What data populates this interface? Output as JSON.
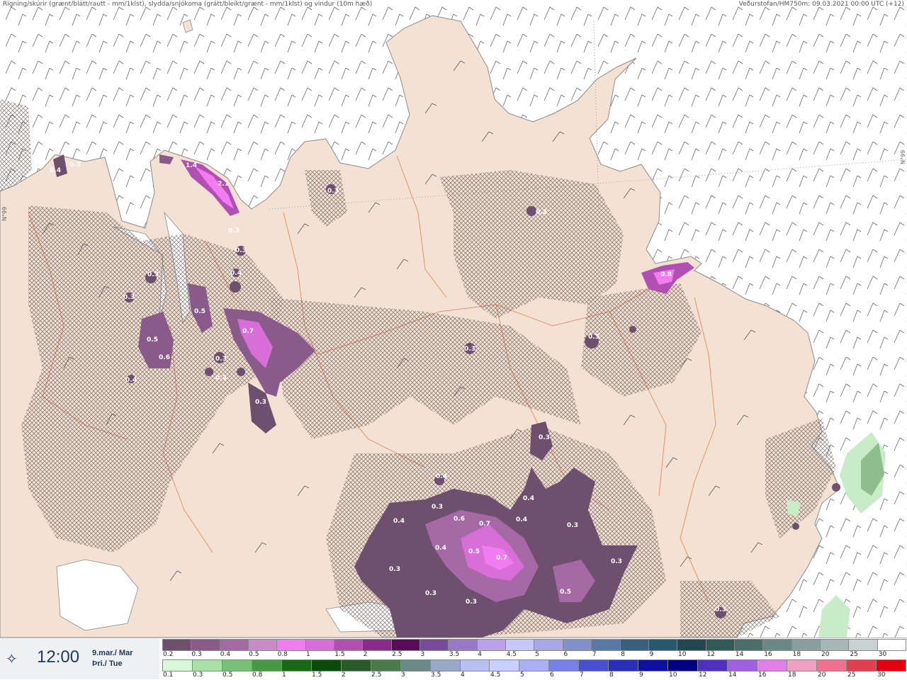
{
  "header": {
    "left": "Rigning/skúrir (grænt/blátt/rautt - mm/1klst), slydda/snjókoma (grátt/bleikt/grænt - mm/1klst) og vindur (10m hæð)",
    "right": "Veðurstofan/HM750m: 09.03.2021 00:00 UTC (+12)"
  },
  "latitude_labels": [
    "N°99",
    "N°99"
  ],
  "precip_labels": [
    "0.4",
    "0.3",
    "1.4",
    "2.1",
    "0.3",
    "0.3",
    "0.4",
    "0.3",
    "0.3",
    "0.5",
    "0.7",
    "0.5",
    "0.6",
    "0.3",
    "0.3",
    "0.3",
    "0.4",
    "0.3",
    "0.2",
    "0.8",
    "0.3",
    "0.3",
    "0.3",
    "0.4",
    "0.3",
    "0.4",
    "0.6",
    "0.7",
    "0.4",
    "0.4",
    "0.3",
    "0.4",
    "0.5",
    "0.7",
    "0.3",
    "0.3",
    "0.5",
    "0.3",
    "0.3",
    "0.3"
  ],
  "time": {
    "icon": "time-icon",
    "value": "12:00",
    "date_line1": "9.mar./ Mar",
    "date_line2": "Þri./ Tue"
  },
  "scale_snow": {
    "ticks": [
      "0.2",
      "0.3",
      "0.4",
      "0.5",
      "0.8",
      "1",
      "1.5",
      "2",
      "2.5",
      "3",
      "3.5",
      "4",
      "4.5",
      "5",
      "6",
      "7",
      "8",
      "9",
      "10",
      "12",
      "14",
      "16",
      "18",
      "20",
      "25",
      "30"
    ],
    "colors": [
      "#6e4f6e",
      "#8a5a8a",
      "#a56aa5",
      "#c98ac9",
      "#f07cf0",
      "#d86fd8",
      "#b24fb2",
      "#8a2a8a",
      "#5a0a5a",
      "#7a4a9a",
      "#9a78c8",
      "#b9a0e8",
      "#c8c8f8",
      "#a8a8e8",
      "#8090c8",
      "#5878a8",
      "#3a6080",
      "#285870",
      "#204850",
      "#305a58",
      "#4a6e6a",
      "#6a8888",
      "#8aa0a0",
      "#a8b8b8",
      "#c8d2d2",
      "#ffffff"
    ]
  },
  "scale_rain": {
    "ticks": [
      "0.1",
      "0.3",
      "0.5",
      "0.8",
      "1",
      "1.5",
      "2",
      "2.5",
      "3",
      "3.5",
      "4",
      "4.5",
      "5",
      "6",
      "7",
      "8",
      "9",
      "10",
      "12",
      "14",
      "16",
      "18",
      "20",
      "25",
      "30"
    ],
    "colors": [
      "#d8f8d8",
      "#a8e0a8",
      "#78c078",
      "#489848",
      "#186818",
      "#0a4a0a",
      "#2a5a2a",
      "#4a7a4a",
      "#6a8a8a",
      "#98a8c8",
      "#b8c0f0",
      "#c8d0ff",
      "#a8b0f8",
      "#7880e8",
      "#4850d0",
      "#2830b8",
      "#1010a0",
      "#000080",
      "#5030c0",
      "#a060e0",
      "#e080e8",
      "#f0a0c0",
      "#f07090",
      "#e04050",
      "#e00010"
    ]
  }
}
